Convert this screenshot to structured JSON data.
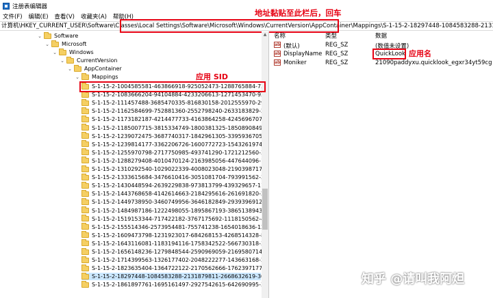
{
  "window": {
    "title": "注册表编辑器"
  },
  "menu": [
    "文件(F)",
    "编辑(E)",
    "查看(V)",
    "收藏夹(A)",
    "帮助(H)"
  ],
  "address": "计算机\\HKEY_CURRENT_USER\\Software\\Classes\\Local Settings\\Software\\Microsoft\\Windows\\CurrentVersion\\AppContainer\\Mappings\\S-1-15-2-18297448-1084583288-2131879811-2668632619-3046306",
  "tree": [
    {
      "label": "Software"
    },
    {
      "label": "Microsoft"
    },
    {
      "label": "Windows"
    },
    {
      "label": "CurrentVersion"
    },
    {
      "label": "AppContainer"
    },
    {
      "label": "Mappings"
    }
  ],
  "sids": [
    "S-1-15-2-1004585581-463866918-925052473-1288765884-73082962-4",
    "S-1-15-2-1083666204-94104884-4233206613-1271453470-922726920",
    "S-1-15-2-111457488-3685470335-816830158-2012555970-292650529",
    "S-1-15-2-1162584699-752881360-2552798240-2633183829-22194059",
    "S-1-15-2-1173182187-4214477733-4163864258-4245696707-2071662",
    "S-1-15-2-1185007715-3815334749-1800381325-1850890849-3228979",
    "S-1-15-2-1239072475-3687740317-1842961305-3395936705-4023953",
    "S-1-15-2-1239814177-3362206726-1600772723-1543261974-4201403",
    "S-1-15-2-1255970798-2717750985-493741290-1721212560-35307986",
    "S-1-15-2-1288279408-4010470124-2163985056-447644096-19460372",
    "S-1-15-2-1310292540-1029022339-4008023048-2190398717-5396199",
    "S-1-15-2-1333615684-3476610416-3051081704-793991562-34135157",
    "S-1-15-2-1430448594-2639229838-973813799-439329657-11979848",
    "S-1-15-2-1443768658-4142614663-2184295616-261691820-2296379",
    "S-1-15-2-1449738950-3460749956-3646182849-2939396912-2375441",
    "S-1-15-2-1484987186-1222498055-1895867193-3865138943-3428356",
    "S-1-15-2-1519153344-717422182-3767175692-1118150562-40474979",
    "S-1-15-2-155514346-2573954481-755741238-1654018636-12333182",
    "S-1-15-2-1609473798-1231923017-684268153-4268514328-8827736",
    "S-1-15-2-1643116081-1183194116-1758342522-566730318-32383557",
    "S-1-15-2-1656148236-1279848544-2590969059-2169580714-3959213",
    "S-1-15-2-1714399563-1326177402-2048222277-143663168-21513197",
    "S-1-15-2-1823635404-1364722122-2170562666-1762397177-2399050",
    "S-1-15-2-18297448-1084583288-2131879811-2668632619-30463067",
    "S-1-15-2-1861897761-1695161497-2927542615-642690995-32784028"
  ],
  "selected_sid_index": 23,
  "values": {
    "headers": {
      "name": "名称",
      "type": "类型",
      "data": "数据"
    },
    "rows": [
      {
        "icon": "ab-icon",
        "name": "(默认)",
        "type": "REG_SZ",
        "data": "(数值未设置)"
      },
      {
        "icon": "ab-icon",
        "name": "DisplayName",
        "type": "REG_SZ",
        "data": "QuickLook"
      },
      {
        "icon": "ab-icon",
        "name": "Moniker",
        "type": "REG_SZ",
        "data": "21090paddyxu.quicklook_egxr34yt59cg"
      }
    ]
  },
  "annotations": {
    "address_note": "地址黏贴至此栏后，回车",
    "sid_note": "应用 SID",
    "app_note": "应用名"
  },
  "watermark": "知乎 @请叫我阿炟",
  "colors": {
    "highlight": "#e60012",
    "folder": "#f5cf63",
    "selection": "#cce8ff"
  }
}
